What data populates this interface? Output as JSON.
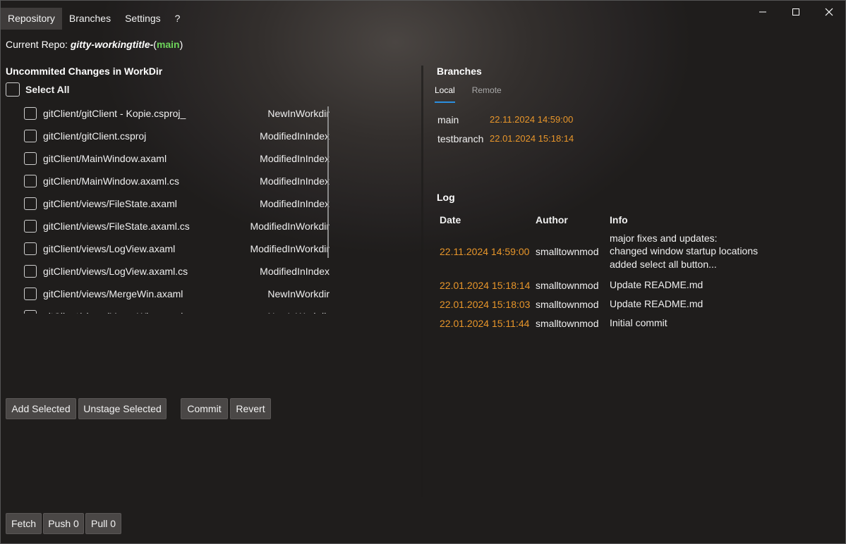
{
  "menu": [
    {
      "label": "Repository"
    },
    {
      "label": "Branches"
    },
    {
      "label": "Settings"
    },
    {
      "label": "?"
    }
  ],
  "window_controls": {
    "minimize": "minimize-icon",
    "maximize": "maximize-icon",
    "close": "close-icon"
  },
  "repo": {
    "prefix": "Current Repo:",
    "name": "gitty-workingtitle-",
    "open_paren": "(",
    "branch": "main",
    "close_paren": ")"
  },
  "changes": {
    "title": "Uncommited Changes in WorkDir",
    "select_all": "Select All",
    "files": [
      {
        "path": "gitClient/gitClient - Kopie.csproj_",
        "state": "NewInWorkdir"
      },
      {
        "path": "gitClient/gitClient.csproj",
        "state": "ModifiedInIndex"
      },
      {
        "path": "gitClient/MainWindow.axaml",
        "state": "ModifiedInIndex"
      },
      {
        "path": "gitClient/MainWindow.axaml.cs",
        "state": "ModifiedInIndex"
      },
      {
        "path": "gitClient/views/FileState.axaml",
        "state": "ModifiedInIndex"
      },
      {
        "path": "gitClient/views/FileState.axaml.cs",
        "state": "ModifiedInWorkdir"
      },
      {
        "path": "gitClient/views/LogView.axaml",
        "state": "ModifiedInWorkdir"
      },
      {
        "path": "gitClient/views/LogView.axaml.cs",
        "state": "ModifiedInIndex"
      },
      {
        "path": "gitClient/views/MergeWin.axaml",
        "state": "NewInWorkdir"
      },
      {
        "path": "gitClient/views/MergeWin.axaml.cs",
        "state": "NewInWorkdir"
      }
    ]
  },
  "actions": {
    "add_selected": "Add Selected",
    "unstage_selected": "Unstage Selected",
    "commit": "Commit",
    "revert": "Revert"
  },
  "remote_actions": {
    "fetch": "Fetch",
    "push": "Push 0",
    "pull": "Pull 0"
  },
  "branches": {
    "title": "Branches",
    "tabs": [
      {
        "label": "Local"
      },
      {
        "label": "Remote"
      }
    ],
    "items": [
      {
        "name": "main",
        "date": "22.11.2024 14:59:00"
      },
      {
        "name": "testbranch",
        "date": "22.01.2024 15:18:14"
      }
    ]
  },
  "log": {
    "title": "Log",
    "headers": {
      "date": "Date",
      "author": "Author",
      "info": "Info"
    },
    "rows": [
      {
        "date": "22.11.2024 14:59:00",
        "author": "smalltownmod",
        "info": [
          "major fixes and updates:",
          "changed window startup locations",
          "added select all button..."
        ]
      },
      {
        "date": "22.01.2024 15:18:14",
        "author": "smalltownmod",
        "info": [
          "Update README.md"
        ]
      },
      {
        "date": "22.01.2024 15:18:03",
        "author": "smalltownmod",
        "info": [
          "Update README.md"
        ]
      },
      {
        "date": "22.01.2024 15:11:44",
        "author": "smalltownmod",
        "info": [
          "Initial commit"
        ]
      }
    ]
  },
  "colors": {
    "accent": "#2b8fe0",
    "date": "#e8962a",
    "branch": "#6dd35a"
  }
}
